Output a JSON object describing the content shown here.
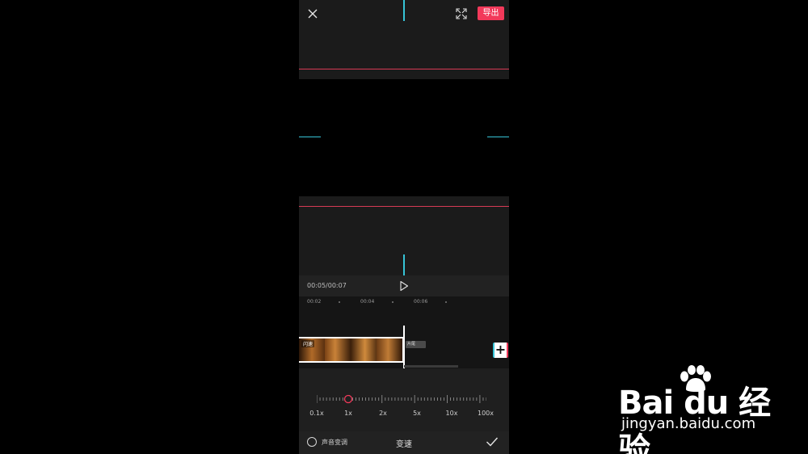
{
  "toolbar": {
    "export_label": "导出"
  },
  "player": {
    "timecode": "00:05/00:07"
  },
  "timeline": {
    "ticks": [
      "00:02",
      "00:04",
      "00:06"
    ],
    "clip_badge": "闪速",
    "ending_label": "片尾"
  },
  "speed": {
    "labels": [
      "0.1x",
      "1x",
      "2x",
      "5x",
      "10x",
      "100x"
    ],
    "current": "1x"
  },
  "bottom": {
    "pitch_label": "声音变调",
    "title": "变速"
  },
  "watermark": {
    "brand": "Bai du 经验",
    "url": "jingyan.baidu.com"
  },
  "colors": {
    "accent": "#f2395a",
    "guide": "#36c3d6",
    "background": "#1b1b1b"
  }
}
